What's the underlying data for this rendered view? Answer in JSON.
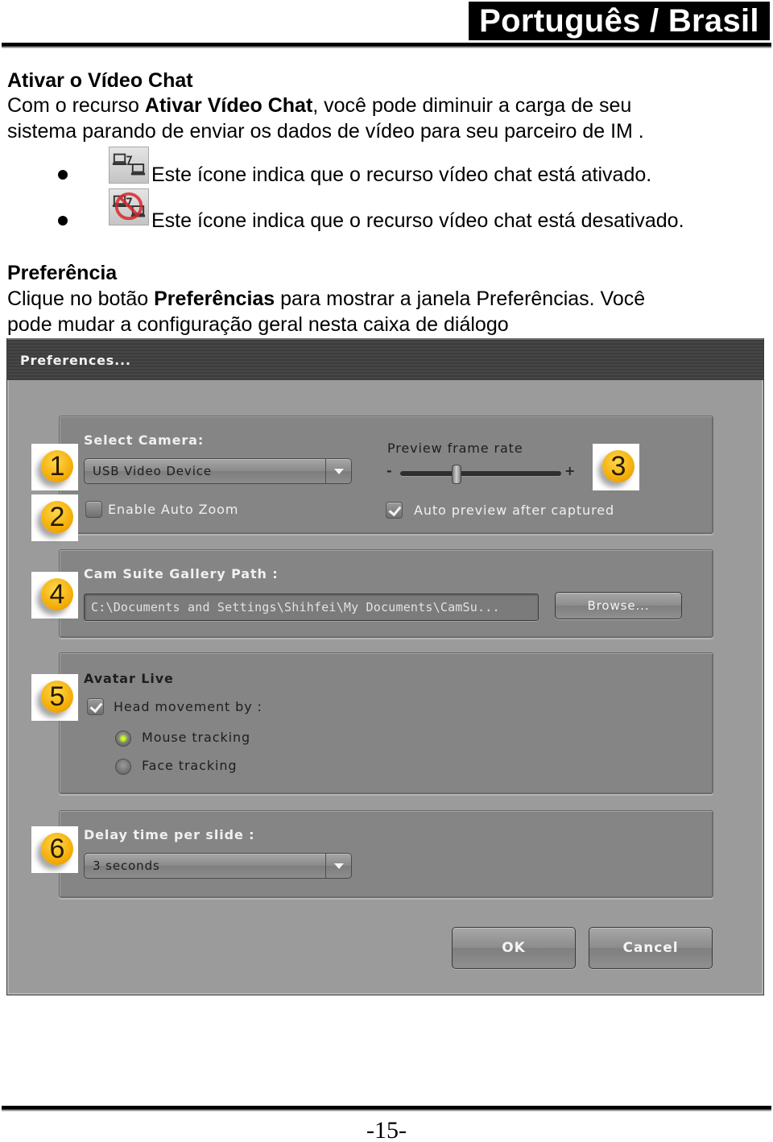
{
  "header": {
    "language_banner": "Português / Brasil"
  },
  "section_video_chat": {
    "heading": "Ativar o Vídeo Chat",
    "para_line1_prefix": "Com o recurso ",
    "para_line1_bold": "Ativar Vídeo Chat",
    "para_line1_suffix": ", você pode diminuir a carga de seu",
    "para_line2": "sistema parando de enviar os dados de vídeo para seu parceiro de IM .",
    "bullets": [
      {
        "icon": "video-chat-enabled-icon",
        "text": "Este ícone indica que o recurso vídeo chat está ativado."
      },
      {
        "icon": "video-chat-disabled-icon",
        "text": "Este ícone indica que o recurso vídeo chat está desativado."
      }
    ]
  },
  "section_preferences": {
    "heading": "Preferência",
    "para_line1_prefix": "Clique no botão ",
    "para_line1_bold": "Preferências",
    "para_line1_suffix": " para mostrar a janela Preferências. Você",
    "para_line2": "pode mudar a configuração geral nesta caixa de diálogo"
  },
  "dialog": {
    "title": "Preferences...",
    "camera": {
      "label": "Select Camera:",
      "selected": "USB Video Device",
      "auto_zoom_label": "Enable Auto Zoom",
      "auto_zoom_checked": false
    },
    "preview": {
      "label": "Preview frame rate",
      "minus": "-",
      "plus": "+",
      "frame_rate_fraction": 0.35,
      "auto_preview_label": "Auto preview after captured",
      "auto_preview_checked": true
    },
    "gallery": {
      "label": "Cam Suite Gallery Path :",
      "path_value": "C:\\Documents and Settings\\Shihfei\\My Documents\\CamSu...",
      "browse_label": "Browse..."
    },
    "avatar": {
      "label": "Avatar Live",
      "head_movement_label": "Head movement by :",
      "head_movement_checked": true,
      "options": [
        {
          "label": "Mouse tracking",
          "selected": true
        },
        {
          "label": "Face tracking",
          "selected": false
        }
      ]
    },
    "slideshow": {
      "label": "Delay time per slide :",
      "selected": "3 seconds"
    },
    "ok_label": "OK",
    "cancel_label": "Cancel",
    "markers": [
      "1",
      "2",
      "3",
      "4",
      "5",
      "6"
    ],
    "marker_color": "#f2a800"
  },
  "footer": {
    "page_number": "-15-"
  }
}
